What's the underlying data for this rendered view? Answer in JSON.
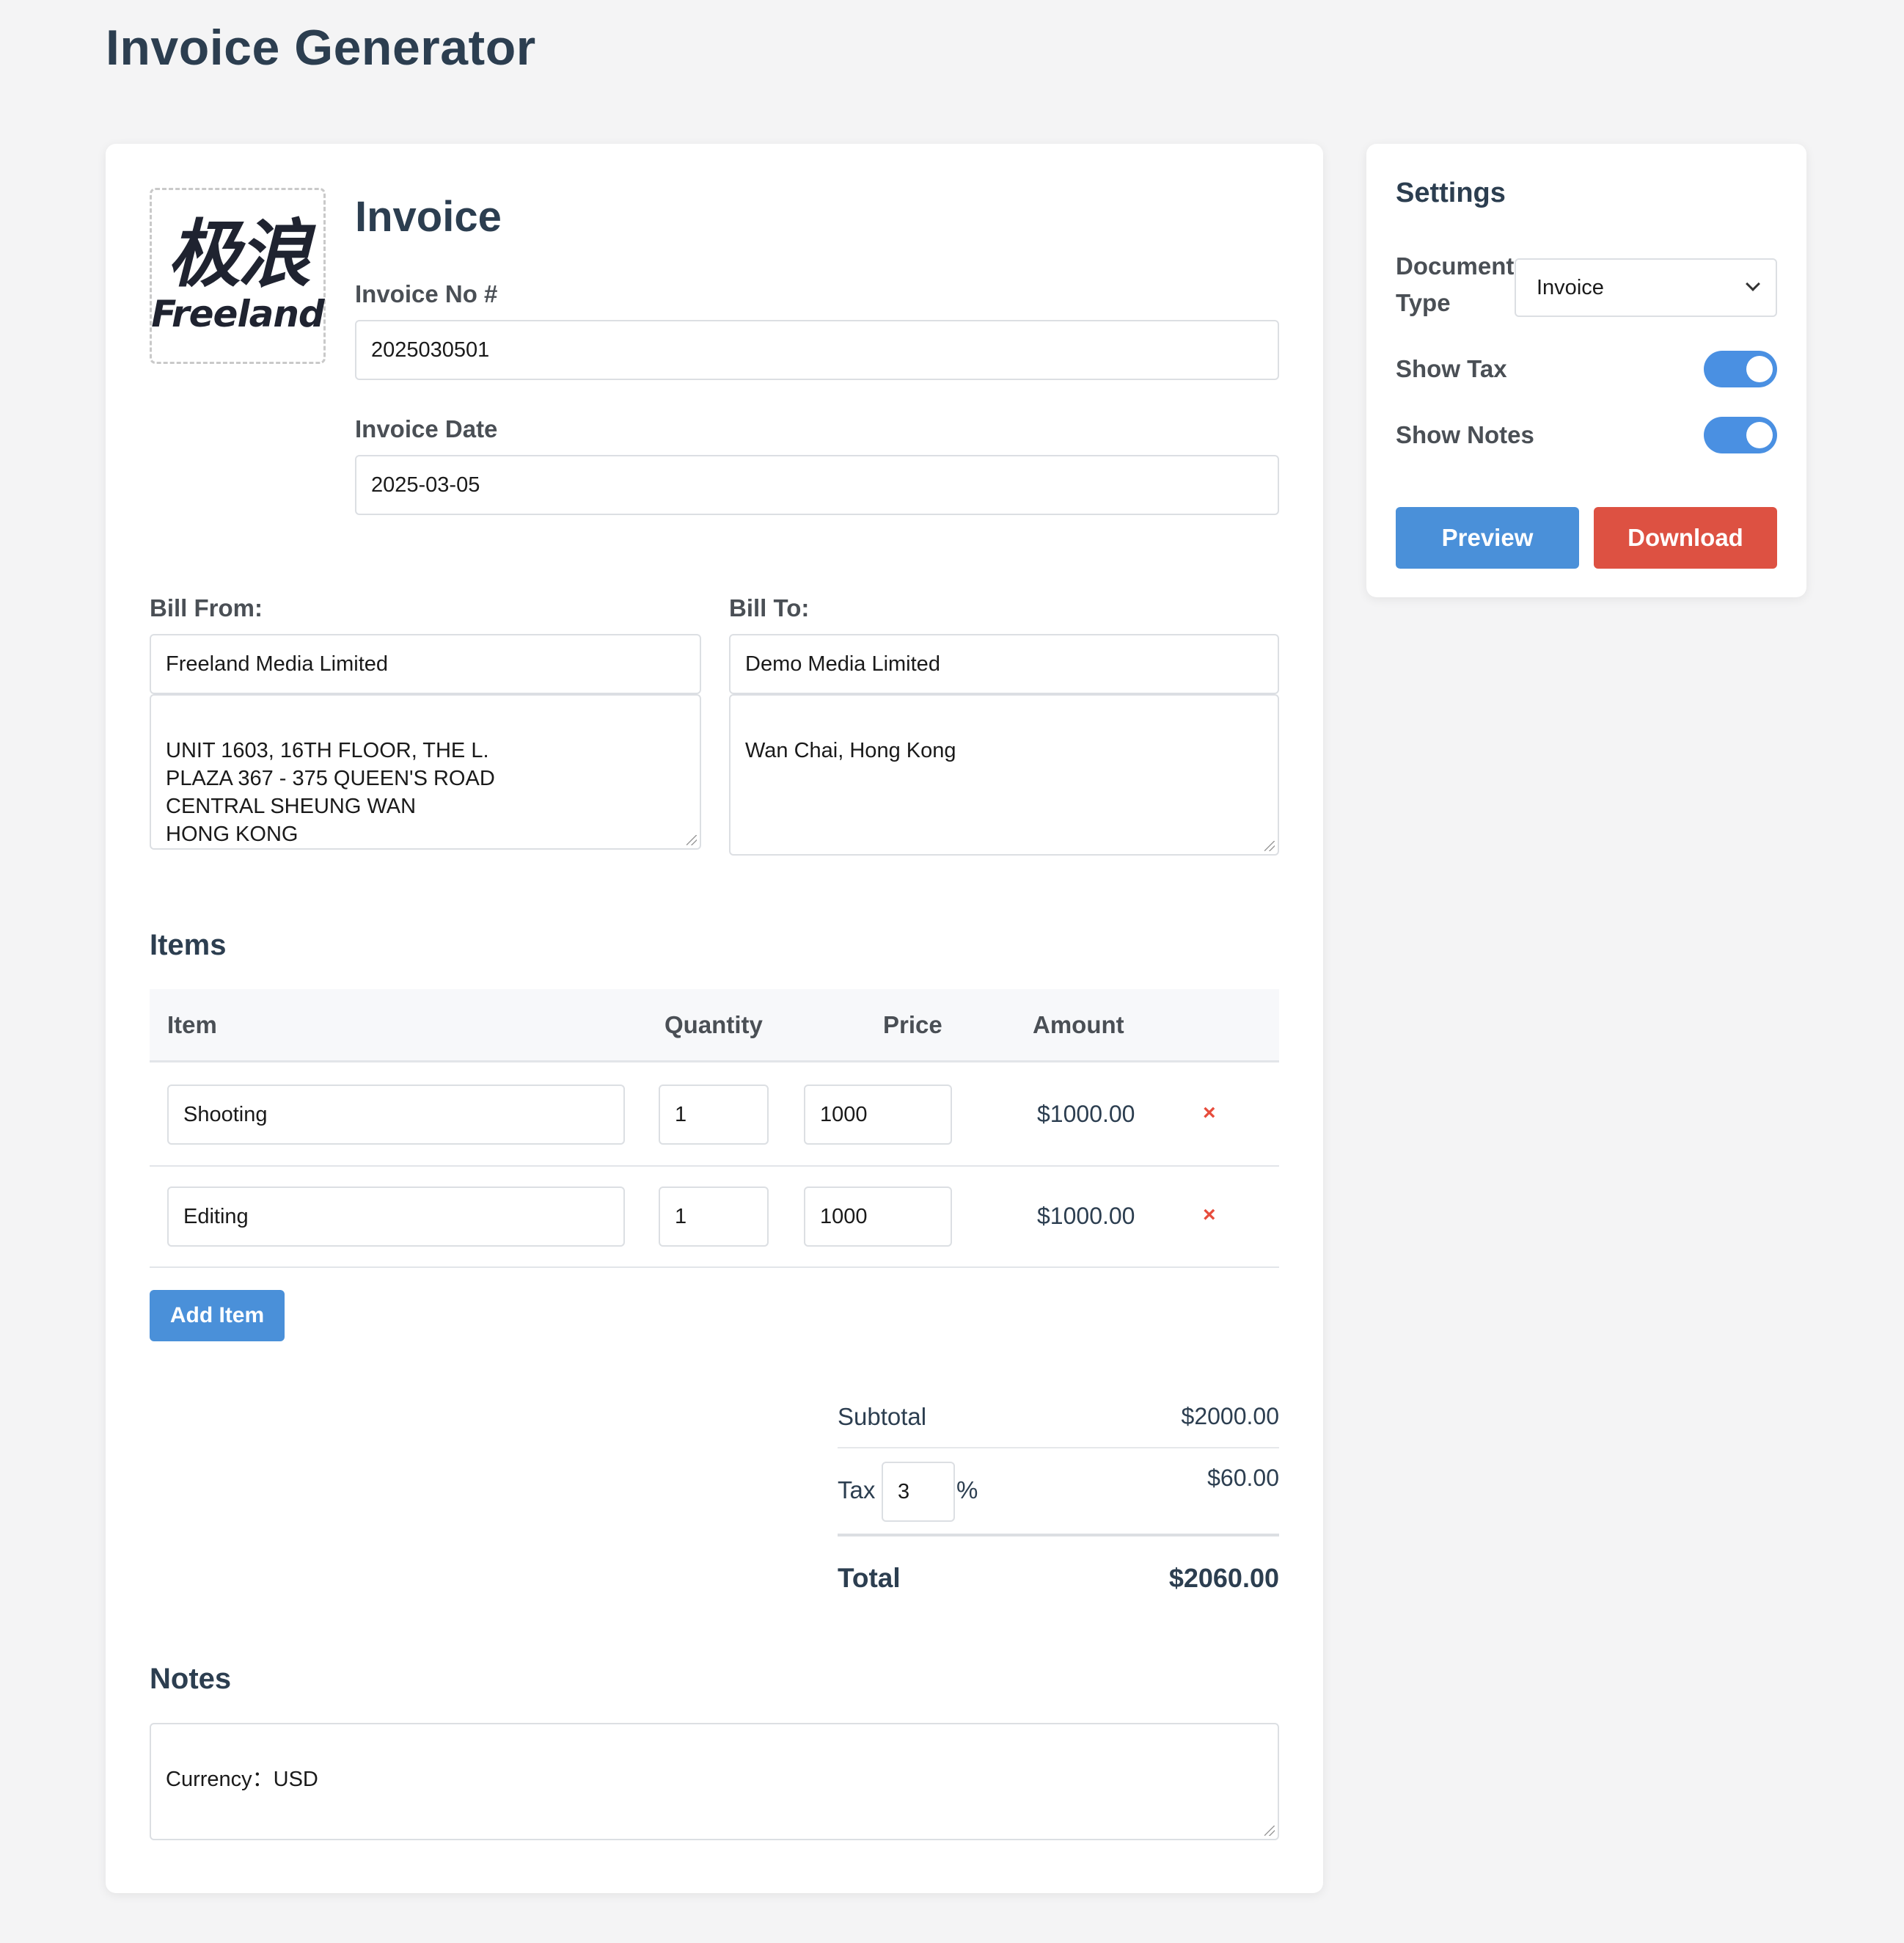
{
  "page": {
    "title": "Invoice Generator"
  },
  "header": {
    "logo": {
      "cn": "极浪",
      "en": "Freeland"
    },
    "doc_heading": "Invoice",
    "invoice_no_label": "Invoice No #",
    "invoice_no": "2025030501",
    "invoice_date_label": "Invoice Date",
    "invoice_date": "2025-03-05"
  },
  "bill_from": {
    "label": "Bill From:",
    "name": "Freeland Media Limited",
    "address": "UNIT 1603, 16TH FLOOR, THE L.\nPLAZA 367 - 375 QUEEN'S ROAD\nCENTRAL SHEUNG WAN\nHONG KONG"
  },
  "bill_to": {
    "label": "Bill To:",
    "name": "Demo Media Limited",
    "address": "Wan Chai, Hong Kong"
  },
  "items": {
    "heading": "Items",
    "columns": {
      "item": "Item",
      "quantity": "Quantity",
      "price": "Price",
      "amount": "Amount"
    },
    "rows": [
      {
        "item": "Shooting",
        "quantity": "1",
        "price": "1000",
        "amount": "$1000.00",
        "remove": "×"
      },
      {
        "item": "Editing",
        "quantity": "1",
        "price": "1000",
        "amount": "$1000.00",
        "remove": "×"
      }
    ],
    "add_label": "Add Item"
  },
  "totals": {
    "subtotal_label": "Subtotal",
    "subtotal": "$2000.00",
    "tax_label": "Tax",
    "tax_rate": "3",
    "tax_unit": "%",
    "tax": "$60.00",
    "total_label": "Total",
    "total": "$2060.00"
  },
  "notes": {
    "heading": "Notes",
    "text": "Currency：USD"
  },
  "settings": {
    "title": "Settings",
    "document_type_label": "Document\nType",
    "document_type": "Invoice",
    "show_tax_label": "Show Tax",
    "show_tax": true,
    "show_notes_label": "Show Notes",
    "show_notes": true,
    "preview_label": "Preview",
    "download_label": "Download"
  },
  "colors": {
    "accent": "#4a90d9",
    "danger": "#dd5142",
    "text": "#2c3e50"
  }
}
